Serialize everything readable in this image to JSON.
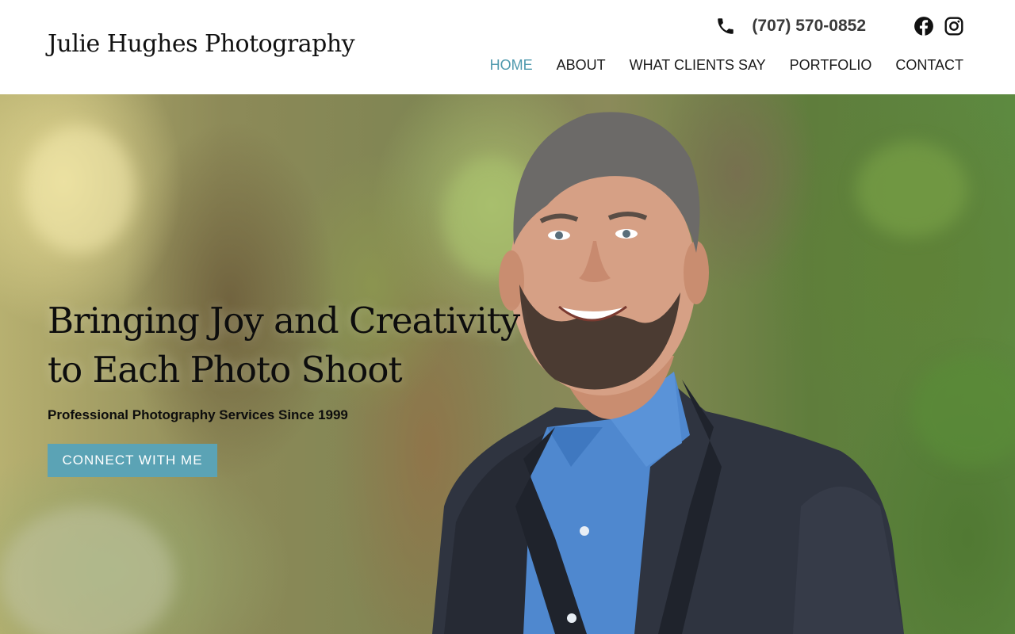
{
  "brand": {
    "name": "Julie Hughes Photography"
  },
  "header": {
    "phone": "(707) 570-0852",
    "social": [
      "facebook-icon",
      "instagram-icon"
    ]
  },
  "nav": {
    "items": [
      {
        "label": "HOME",
        "active": true
      },
      {
        "label": "ABOUT",
        "active": false
      },
      {
        "label": "WHAT CLIENTS SAY",
        "active": false
      },
      {
        "label": "PORTFOLIO",
        "active": false
      },
      {
        "label": "CONTACT",
        "active": false
      }
    ]
  },
  "hero": {
    "title_line1": "Bringing Joy and Creativity",
    "title_line2": "to Each Photo Shoot",
    "subtitle": "Professional Photography Services Since 1999",
    "cta_label": "CONNECT WITH ME"
  },
  "colors": {
    "accent": "#5ba3b5",
    "nav_active": "#4e99ad",
    "text": "#1a1a1a"
  }
}
